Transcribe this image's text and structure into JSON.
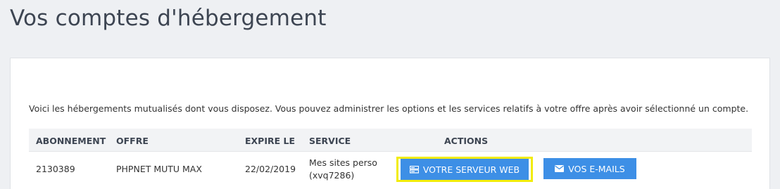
{
  "page": {
    "title": "Vos comptes d'hébergement"
  },
  "intro": "Voici les hébergements mutualisés dont vous disposez. Vous pouvez administrer les options et les services relatifs à votre offre après avoir sélectionné un compte.",
  "table": {
    "headers": [
      "ABONNEMENT",
      "OFFRE",
      "EXPIRE LE",
      "SERVICE",
      "ACTIONS"
    ],
    "rows": [
      {
        "abonnement": "2130389",
        "offre": "PHPNET MUTU MAX",
        "expire": "22/02/2019",
        "service_line1": "Mes sites perso",
        "service_line2": "(xvq7286)",
        "actions": {
          "web_label": "VOTRE SERVEUR WEB",
          "web_icon": "server-icon",
          "mail_label": "VOS E-MAILS",
          "mail_icon": "envelope-icon"
        }
      }
    ]
  },
  "colors": {
    "background": "#eef0f3",
    "button": "#3d8fe6",
    "highlight": "#f2ec0c",
    "title": "#3d4552"
  }
}
